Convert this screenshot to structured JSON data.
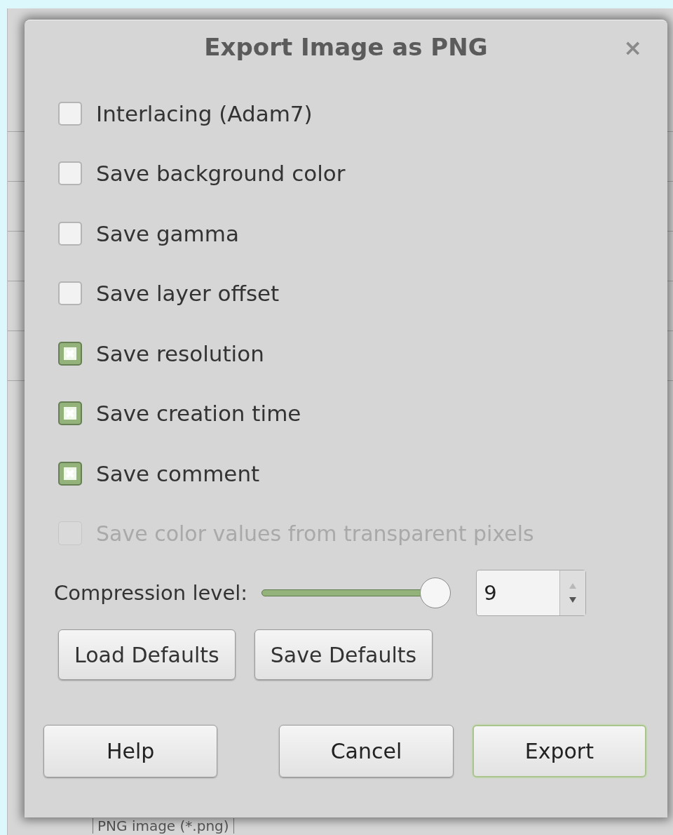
{
  "dialog": {
    "title": "Export Image as PNG",
    "close": "×"
  },
  "options": [
    {
      "label": "Interlacing (Adam7)",
      "checked": false,
      "disabled": false
    },
    {
      "label": "Save background color",
      "checked": false,
      "disabled": false
    },
    {
      "label": "Save gamma",
      "checked": false,
      "disabled": false
    },
    {
      "label": "Save layer offset",
      "checked": false,
      "disabled": false
    },
    {
      "label": "Save resolution",
      "checked": true,
      "disabled": false
    },
    {
      "label": "Save creation time",
      "checked": true,
      "disabled": false
    },
    {
      "label": "Save comment",
      "checked": true,
      "disabled": false
    },
    {
      "label": "Save color values from transparent pixels",
      "checked": false,
      "disabled": true
    }
  ],
  "compression": {
    "label": "Compression level:",
    "level": 1,
    "value": "9"
  },
  "defaults_buttons": [
    "Load Defaults",
    "Save Defaults"
  ],
  "buttons": [
    {
      "label": "Help",
      "selected": false
    },
    {
      "label": "Cancel",
      "selected": false
    },
    {
      "label": "Export",
      "selected": true
    }
  ],
  "background": {
    "file_type": "PNG image (*.png)"
  }
}
